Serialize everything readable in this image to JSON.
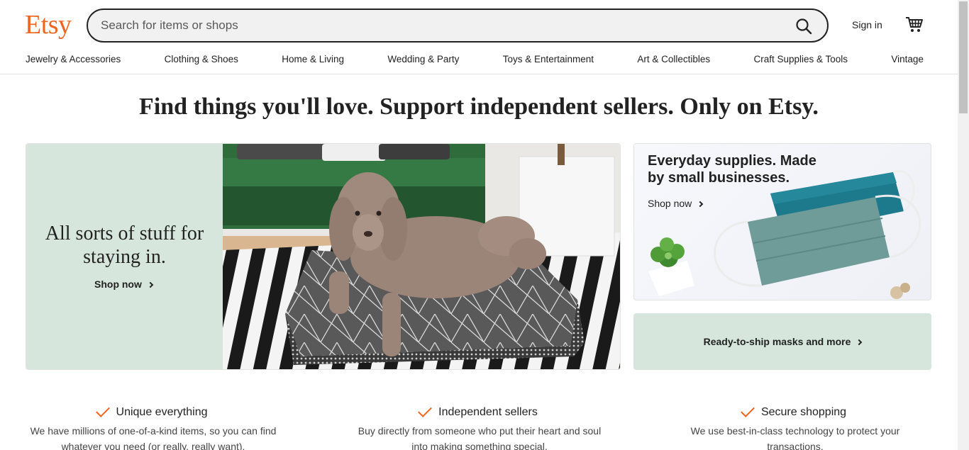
{
  "header": {
    "logo": "Etsy",
    "search_placeholder": "Search for items or shops",
    "sign_in": "Sign in",
    "icons": {
      "search": "search-icon",
      "cart": "cart-icon"
    },
    "brand_color": "#f1641e"
  },
  "categories": [
    "Jewelry & Accessories",
    "Clothing & Shoes",
    "Home & Living",
    "Wedding & Party",
    "Toys & Entertainment",
    "Art & Collectibles",
    "Craft Supplies & Tools",
    "Vintage"
  ],
  "hero": {
    "tagline": "Find things you'll love. Support independent sellers. Only on Etsy.",
    "main": {
      "title": "All sorts of stuff for staying in.",
      "cta": "Shop now",
      "image": "poodle-on-cushion-photo"
    },
    "side": {
      "title": "Everyday supplies. Made by small businesses.",
      "cta": "Shop now",
      "image": "fabric-masks-photo"
    },
    "promo": {
      "cta": "Ready-to-ship masks and more"
    },
    "panel_color": "#d7e6dc"
  },
  "value_props": [
    {
      "title": "Unique everything",
      "desc": "We have millions of one-of-a-kind items, so you can find whatever you need (or really, really want)."
    },
    {
      "title": "Independent sellers",
      "desc": "Buy directly from someone who put their heart and soul into making something special."
    },
    {
      "title": "Secure shopping",
      "desc": "We use best-in-class technology to protect your transactions."
    }
  ]
}
